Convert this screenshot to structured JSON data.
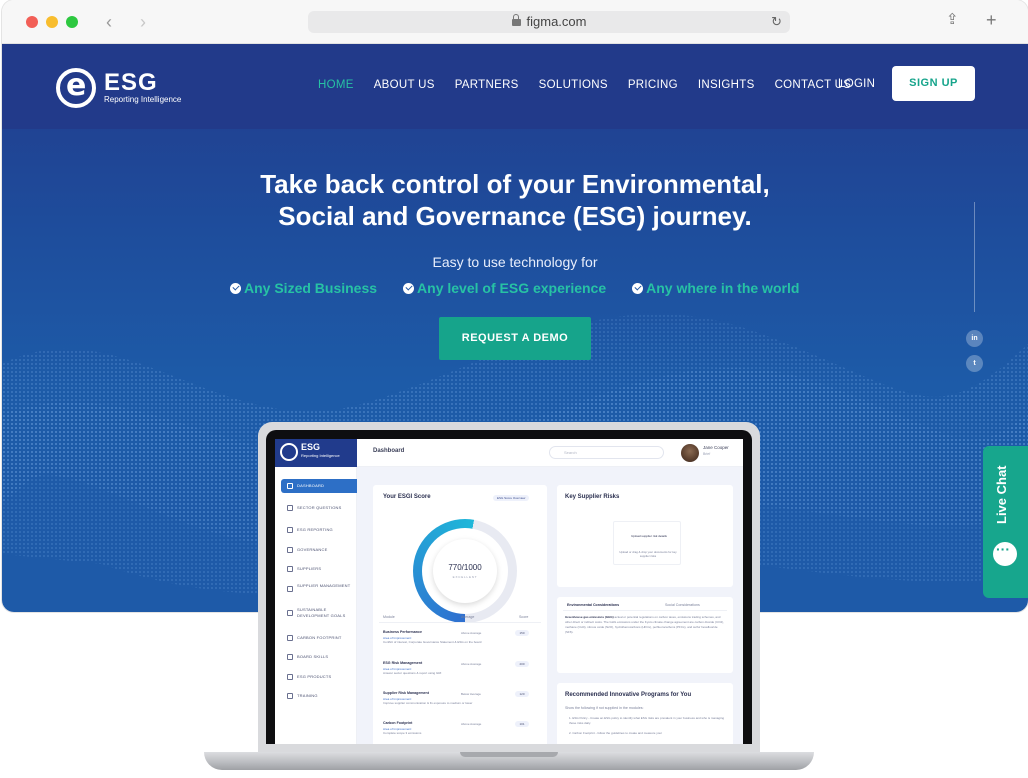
{
  "browser": {
    "url": "figma.com",
    "traffic_lights": [
      "#f25f57",
      "#f8bd2e",
      "#2dc840"
    ]
  },
  "brand": {
    "name": "ESG",
    "subtitle": "Reporting Intelligence"
  },
  "nav": {
    "items": [
      "HOME",
      "ABOUT US",
      "PARTNERS",
      "SOLUTIONS",
      "PRICING",
      "INSIGHTS",
      "CONTACT US"
    ],
    "active": "HOME",
    "login": "LOGIN",
    "signup": "SIGN UP"
  },
  "hero": {
    "headline_line1": "Take back control of your Environmental,",
    "headline_line2": "Social and Governance (ESG) journey.",
    "tagline": "Easy to use technology for",
    "checks": [
      "Any Sized Business",
      "Any level of ESG experience",
      "Any where in the world"
    ],
    "cta": "REQUEST A DEMO"
  },
  "social": {
    "linkedin": "in",
    "twitter": "t"
  },
  "livechat": {
    "label": "Live Chat"
  },
  "dashboard": {
    "brand_name": "ESG",
    "brand_sub": "Reporting Intelligence",
    "title": "Dashboard",
    "search_placeholder": "Search",
    "user_name": "Jane Cooper",
    "user_role": "Brief",
    "sidebar": [
      "DASHBOARD",
      "SECTOR QUESTIONS",
      "ESG REPORTING",
      "GOVERNANCE",
      "SUPPLIERS",
      "SUPPLIER MANAGEMENT",
      "SUSTAINABLE DEVELOPMENT GOALS",
      "CARBON FOOTPRINT",
      "BOARD SKILLS",
      "ESG PRODUCTS",
      "TRAINING"
    ],
    "score_card": {
      "title": "Your ESGI Score",
      "overview_btn": "ESG Score Overview",
      "value": "770/1000",
      "label": "EXCELLENT",
      "columns": [
        "Module",
        "Average",
        "Score"
      ],
      "rows": [
        {
          "module": "Business Performance",
          "average": "Above Average",
          "score": "150",
          "note": "Area of Improvement:",
          "detail": "Conflict of interest, Corporate Governance Statement & ESG on the board"
        },
        {
          "module": "ESG Risk Management",
          "average": "Above Average",
          "score": "200",
          "note": "Area of Improvement:",
          "detail": "Answer sector questions & report using GRI"
        },
        {
          "module": "Supplier Risk Management",
          "average": "Below Average",
          "score": "120",
          "note": "Area of Improvement:",
          "detail": "Improve supplier communication & fix exposure to medium or lower"
        },
        {
          "module": "Carbon Footprint",
          "average": "Above Average",
          "score": "101",
          "note": "Area of Improvement:",
          "detail": "Complete scope 3 emissions"
        }
      ]
    },
    "supplier_card": {
      "title": "Key Supplier Risks",
      "upload_title": "Upload supplier risk details",
      "upload_text": "Upload or drag & drop your documents for key supplier risks"
    },
    "considerations": {
      "tabs": [
        "Environmental Considerations",
        "Social Considerations"
      ],
      "heading": "Greenhouse gas emissions (GHG)",
      "text": "actual or potential regulations on carbon taxes, emissions trading schemes, and other direct or indirect costs. The GHG emissions under the Kyoto climate change agreement are carbon dioxide (CO2), methane (CH4), nitrous oxide (N2O), hydrofluorocarbons (HFCs), perfluorocarbons (PFCs), and sulfur hexafluoride (SF6)."
    },
    "programs": {
      "title": "Recommended Innovative Programs for You",
      "intro": "Show the following if not supplied in the modules:",
      "items": [
        "1. ESG Policy - Create an ESG policy to identify what ESG risks are prevalent in your business and who is managing those risks daily.",
        "2. Carbon Footprint - follow the guidelines to create and measure your"
      ]
    }
  }
}
